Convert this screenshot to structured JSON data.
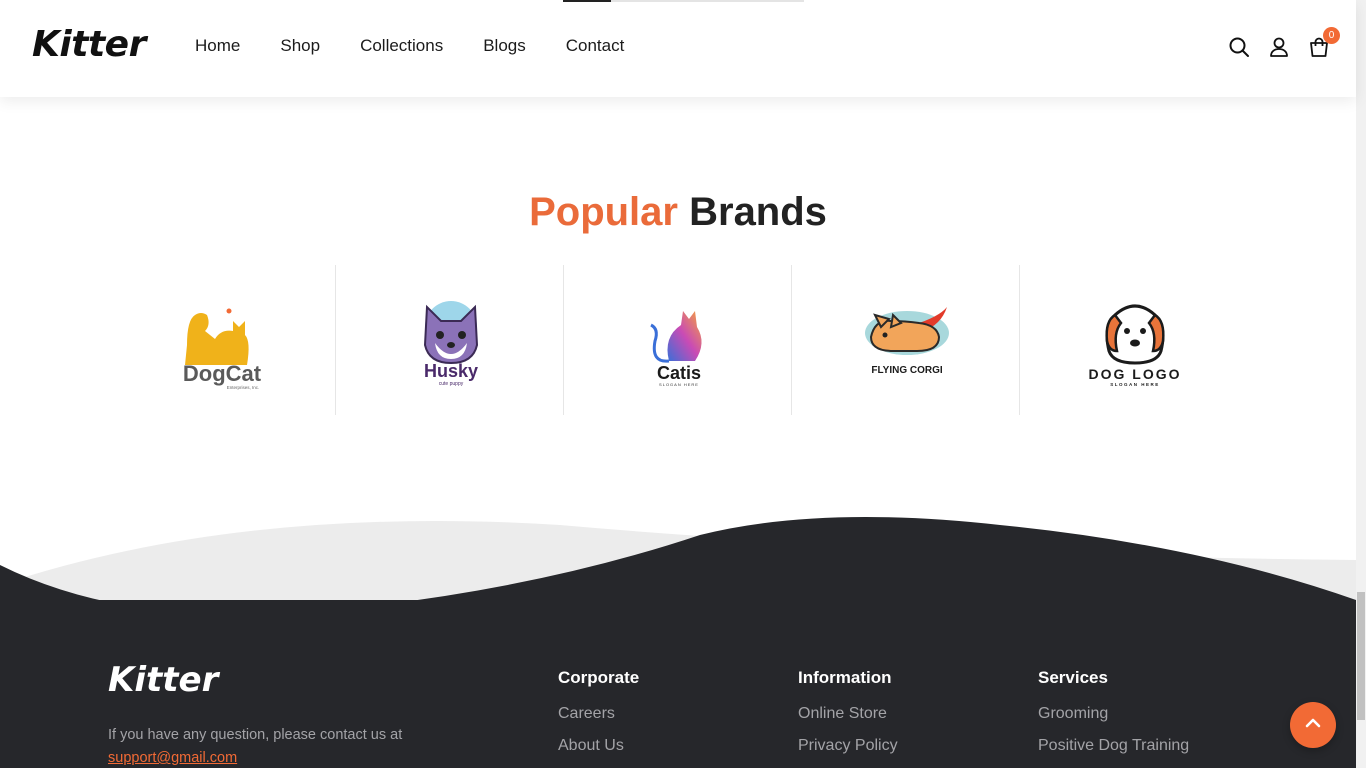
{
  "header": {
    "logo": "Kitter",
    "nav": [
      "Home",
      "Shop",
      "Collections",
      "Blogs",
      "Contact"
    ],
    "cart_count": "0",
    "scroll_progress": 0.2
  },
  "brands": {
    "title_accent": "Popular",
    "title_rest": "Brands",
    "items": [
      {
        "name": "DogCat",
        "sub": "Enterprises, Inc."
      },
      {
        "name": "Husky",
        "sub": "cute puppy"
      },
      {
        "name": "Catis",
        "sub": "SLOGAN HERE"
      },
      {
        "name": "FLYING CORGI",
        "sub": ""
      },
      {
        "name": "DOG LOGO",
        "sub": "SLOGAN HERE"
      }
    ]
  },
  "footer": {
    "logo": "Kitter",
    "contact_text": "If you have any question, please contact us at",
    "email": "support@gmail.com",
    "columns": [
      {
        "title": "Corporate",
        "links": [
          "Careers",
          "About Us"
        ]
      },
      {
        "title": "Information",
        "links": [
          "Online Store",
          "Privacy Policy"
        ]
      },
      {
        "title": "Services",
        "links": [
          "Grooming",
          "Positive Dog Training"
        ]
      }
    ]
  },
  "colors": {
    "accent": "#f26a35",
    "footer_bg": "#26272b",
    "text": "#1b1b1b"
  },
  "icons": [
    "search-icon",
    "user-icon",
    "cart-icon",
    "chevron-up-icon"
  ]
}
